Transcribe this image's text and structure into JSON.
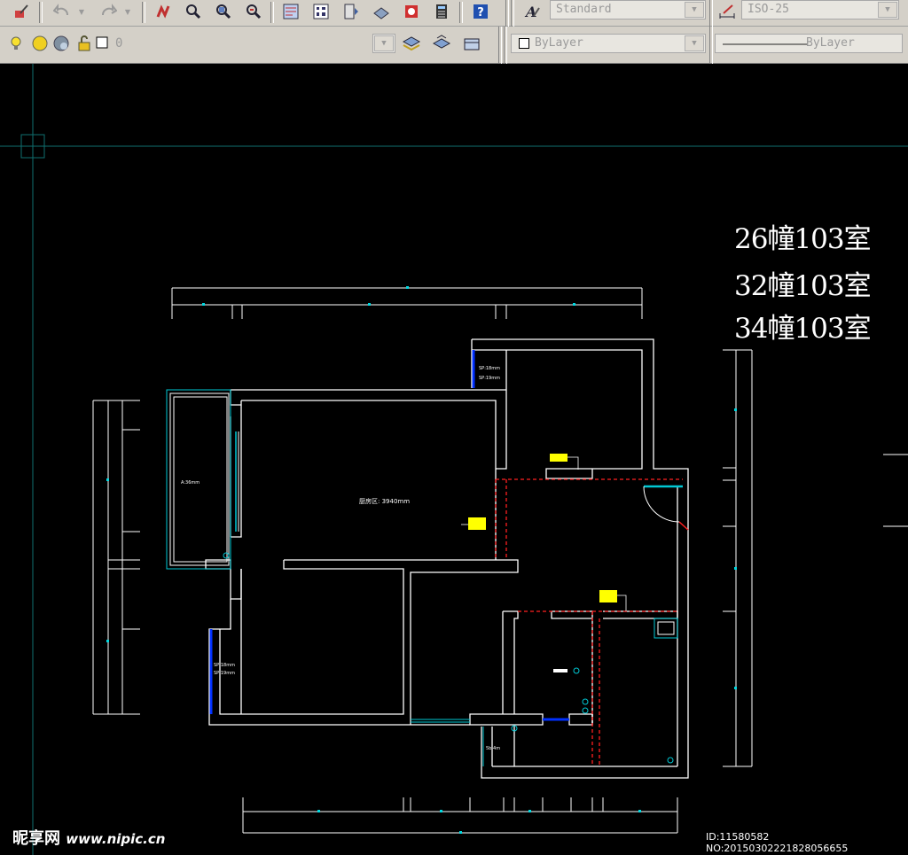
{
  "toolbar": {
    "text_style": "Standard",
    "dim_style": "ISO-25",
    "layer_name": "0",
    "color_control": "ByLayer",
    "linetype_control": "ByLayer"
  },
  "drawing": {
    "title_lines": [
      "26幢103室",
      "32幢103室",
      "34幢103室"
    ],
    "area_label": "厨房区: 3940mm"
  },
  "watermark": {
    "brand": "昵享网",
    "url": "www.nipic.cn",
    "image_id": "ID:11580582 NO:20150302221828056655"
  },
  "colors": {
    "background": "#000000",
    "wall": "#ffffff",
    "window": "#00c8d4",
    "hidden": "#ff2020",
    "door": "#0030ff",
    "tag": "#ffff00",
    "crosshair": "#0f6f6f"
  }
}
